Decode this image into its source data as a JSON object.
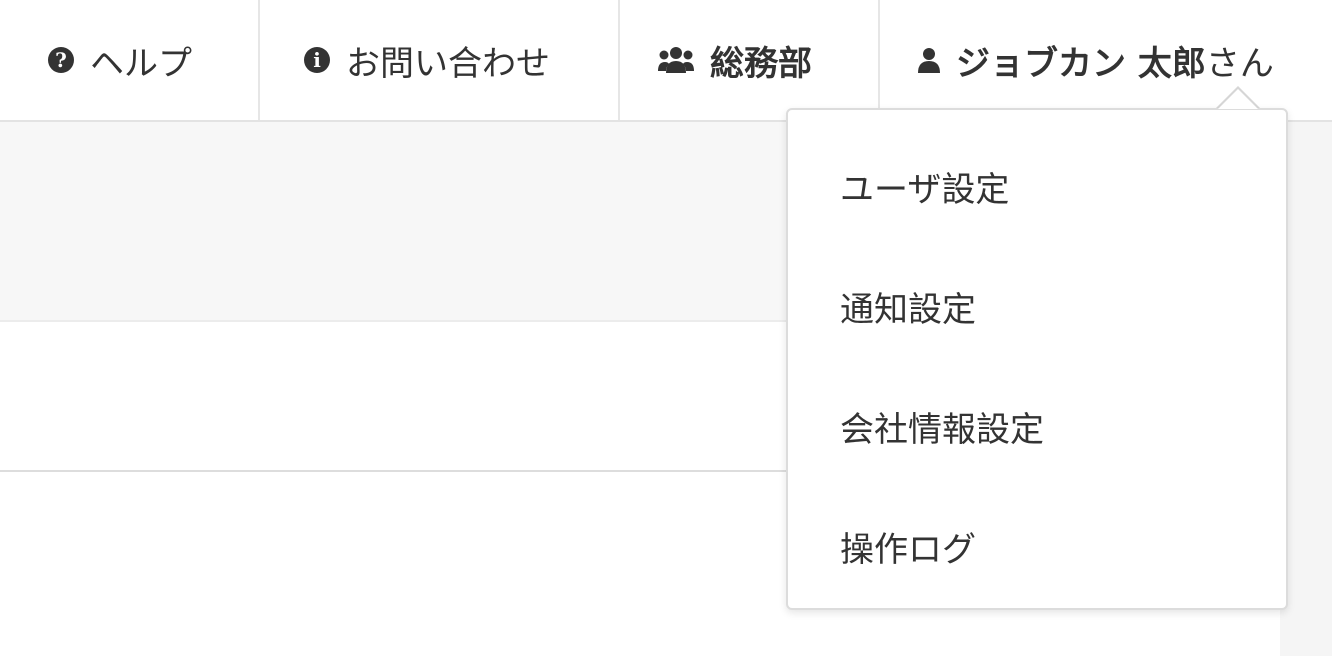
{
  "header": {
    "help": {
      "label": "ヘルプ",
      "icon": "question-circle-icon"
    },
    "contact": {
      "label": "お問い合わせ",
      "icon": "info-circle-icon"
    },
    "department": {
      "label": "総務部",
      "icon": "users-icon"
    },
    "user": {
      "name": "ジョブカン 太郎",
      "suffix": "さん",
      "icon": "user-icon"
    }
  },
  "user_menu": {
    "items": [
      {
        "label": "ユーザ設定"
      },
      {
        "label": "通知設定"
      },
      {
        "label": "会社情報設定"
      },
      {
        "label": "操作ログ"
      }
    ]
  },
  "colors": {
    "text": "#333333",
    "border": "#e3e3e3",
    "panel_gray": "#f7f7f7"
  }
}
